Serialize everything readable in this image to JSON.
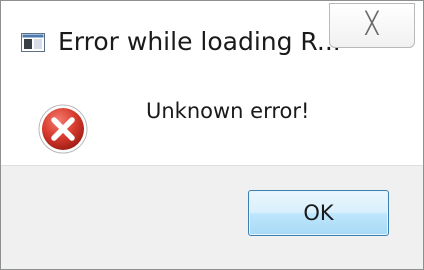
{
  "window": {
    "title": "Error while loading R...",
    "close_glyph": "╳"
  },
  "dialog": {
    "message": "Unknown error!",
    "ok_label": "OK",
    "icon": "error-icon"
  },
  "colors": {
    "error_red": "#c5302c",
    "button_border": "#3c7fb1",
    "button_fill": "#bee6fd"
  }
}
